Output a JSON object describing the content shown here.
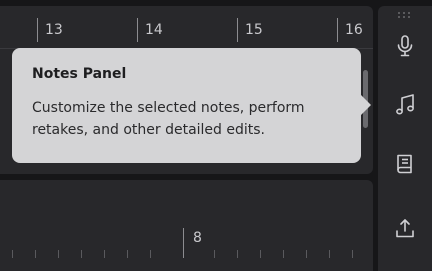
{
  "timeline_top": {
    "ruler_labels": [
      "13",
      "14",
      "15",
      "16"
    ]
  },
  "timeline_bottom": {
    "ruler_labels": [
      "8"
    ]
  },
  "tooltip": {
    "title": "Notes Panel",
    "body": "Customize the selected notes, perform retakes, and other detailed edits."
  },
  "sidebar": {
    "buttons": [
      {
        "name": "microphone-icon"
      },
      {
        "name": "music-notes-icon"
      },
      {
        "name": "book-icon"
      },
      {
        "name": "export-icon"
      }
    ]
  },
  "colors": {
    "tooltip_bg": "#d4d4d6",
    "panel_bg": "#28282b",
    "app_bg": "#161618"
  }
}
